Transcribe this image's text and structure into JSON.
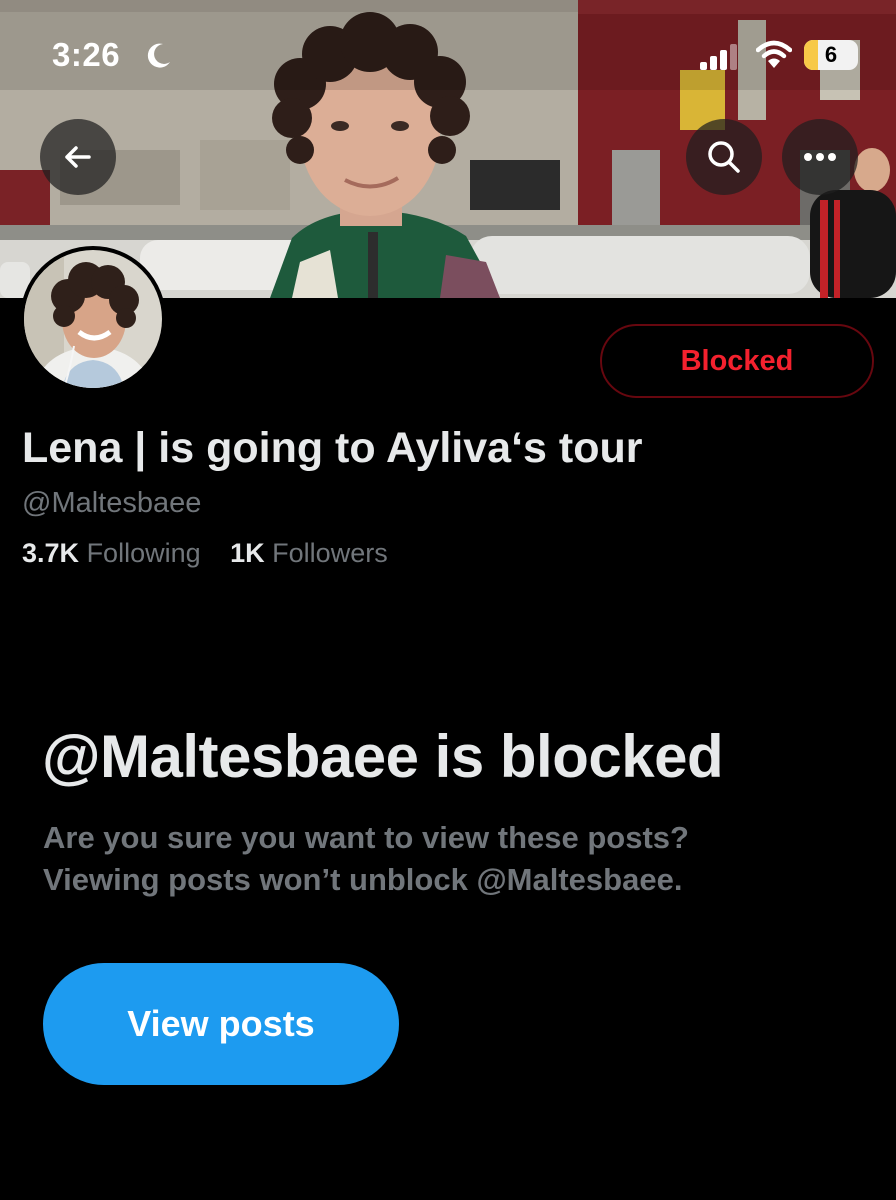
{
  "status_bar": {
    "time": "3:26",
    "focus_icon": "moon-icon",
    "signal_icon": "cellular-signal-icon",
    "wifi_icon": "wifi-icon",
    "battery_level": "6"
  },
  "header": {
    "back_icon": "arrow-left-icon",
    "search_icon": "search-icon",
    "more_icon": "more-horizontal-icon"
  },
  "profile": {
    "display_name": "Lena | is going to Ayliva‘s tour",
    "handle": "@Maltesbaee",
    "blocked_button_label": "Blocked",
    "following_count": "3.7K",
    "following_label": "Following",
    "followers_count": "1K",
    "followers_label": "Followers"
  },
  "blocked_notice": {
    "title": "@Maltesbaee is blocked",
    "line1": "Are you sure you want to view these posts?",
    "line2": "Viewing posts won’t unblock @Maltesbaee.",
    "button_label": "View posts"
  },
  "colors": {
    "background": "#000000",
    "primary_text": "#e7e9ea",
    "secondary_text": "#71767b",
    "accent_blue": "#1d9bf0",
    "blocked_red": "#f4212e"
  }
}
